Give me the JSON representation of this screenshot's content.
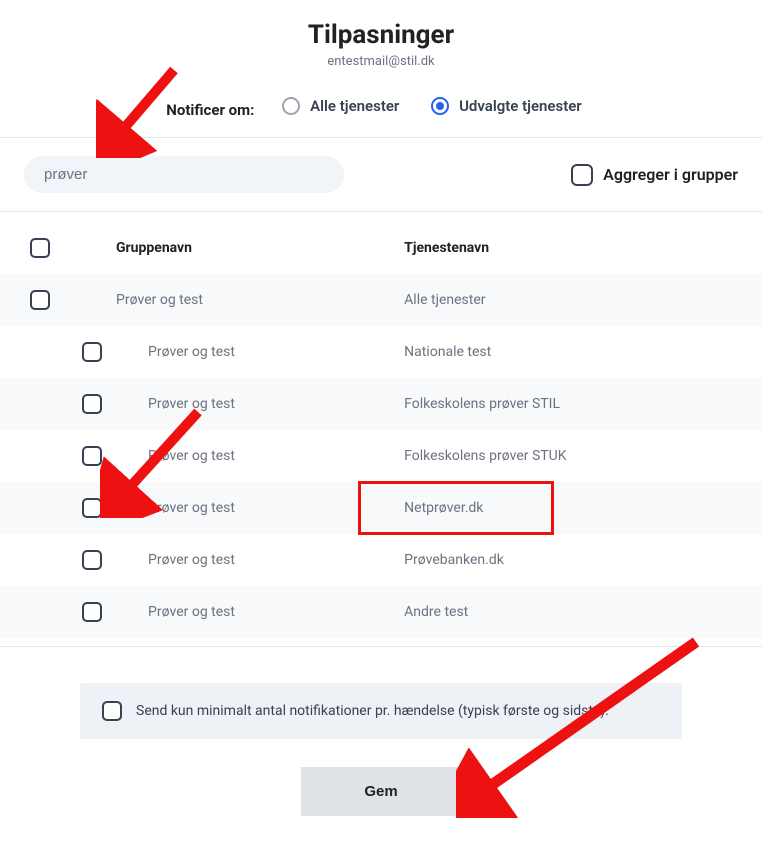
{
  "title": "Tilpasninger",
  "subtitle": "entestmail@stil.dk",
  "notify": {
    "label": "Notificer om:",
    "all": "Alle tjenester",
    "selected": "Udvalgte tjenester",
    "choice": "selected"
  },
  "search": {
    "value": "prøver"
  },
  "aggregate_label": "Aggreger i grupper",
  "headers": {
    "group": "Gruppenavn",
    "service": "Tjenestenavn"
  },
  "rows": [
    {
      "indent": false,
      "shade": true,
      "group": "Prøver og test",
      "service": "Alle tjenester"
    },
    {
      "indent": true,
      "shade": false,
      "group": "Prøver og test",
      "service": "Nationale test"
    },
    {
      "indent": true,
      "shade": true,
      "group": "Prøver og test",
      "service": "Folkeskolens prøver STIL"
    },
    {
      "indent": true,
      "shade": false,
      "group": "Prøver og test",
      "service": "Folkeskolens prøver STUK"
    },
    {
      "indent": true,
      "shade": true,
      "group": "Prøver og test",
      "service": "Netprøver.dk"
    },
    {
      "indent": true,
      "shade": false,
      "group": "Prøver og test",
      "service": "Prøvebanken.dk"
    },
    {
      "indent": true,
      "shade": true,
      "group": "Prøver og test",
      "service": "Andre test"
    }
  ],
  "minimal_label": "Send kun minimalt antal notifikationer pr. hændelse (typisk første og sidste):",
  "save_label": "Gem"
}
